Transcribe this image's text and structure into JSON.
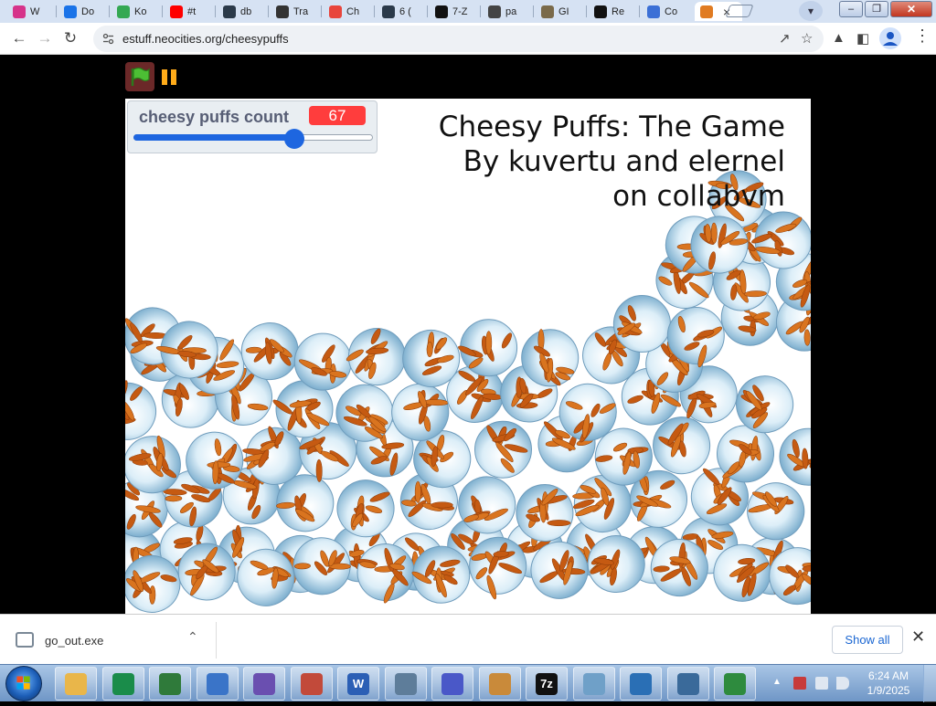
{
  "tabs": [
    {
      "label": "W",
      "icon": "webring-icon",
      "color": "#d6338a",
      "active": false
    },
    {
      "label": "Do",
      "icon": "download-icon",
      "color": "#1a73e8",
      "active": false
    },
    {
      "label": "Ko",
      "icon": "map-pin-icon",
      "color": "#34a853",
      "active": false
    },
    {
      "label": "#t",
      "icon": "youtube-icon",
      "color": "#ff0000",
      "active": false
    },
    {
      "label": "db",
      "icon": "terminal-icon",
      "color": "#2b3a4a",
      "active": false
    },
    {
      "label": "Tra",
      "icon": "lightbulb-icon",
      "color": "#333333",
      "active": false
    },
    {
      "label": "Ch",
      "icon": "chrome-icon",
      "color": "#e8453c",
      "active": false
    },
    {
      "label": "6 (",
      "icon": "terminal-icon",
      "color": "#2b3a4a",
      "active": false
    },
    {
      "label": "7-Z",
      "icon": "7zip-icon",
      "color": "#111111",
      "active": false
    },
    {
      "label": "pa",
      "icon": "archive-icon",
      "color": "#444444",
      "active": false
    },
    {
      "label": "GI",
      "icon": "gimp-icon",
      "color": "#7a6a4a",
      "active": false
    },
    {
      "label": "Re",
      "icon": "github-icon",
      "color": "#111111",
      "active": false
    },
    {
      "label": "Co",
      "icon": "search-icon",
      "color": "#3b6fd6",
      "active": false
    },
    {
      "label": "",
      "icon": "cheesy-puffs-icon",
      "color": "#e07b22",
      "active": true
    }
  ],
  "address": {
    "url": "estuff.neocities.org/cheesypuffs"
  },
  "monitor": {
    "label": "cheesy puffs count",
    "value": "67",
    "slider_fraction": 0.67,
    "accent": "#1e66e0",
    "value_color": "#ff3d3d"
  },
  "game": {
    "title_line1": "Cheesy Puffs: The Game",
    "title_line2": "By kuvertu and elernel",
    "title_line3": "on collabvm",
    "puff_count": 67
  },
  "download": {
    "filename": "go_out.exe",
    "show_all": "Show all"
  },
  "taskbar": {
    "apps": [
      {
        "icon": "explorer-folder-icon",
        "color": "#e9b64a"
      },
      {
        "icon": "green-swirl-icon",
        "color": "#1a8c4a"
      },
      {
        "icon": "globe-icon",
        "color": "#2f7a3a"
      },
      {
        "icon": "pipe-icon",
        "color": "#3a74c8"
      },
      {
        "icon": "virus-icon",
        "color": "#6a4fb0"
      },
      {
        "icon": "spider-icon",
        "color": "#c24a3a"
      },
      {
        "icon": "word-icon",
        "color": "#2b5fb5",
        "text": "W"
      },
      {
        "icon": "pc-shield-icon",
        "color": "#5e7d9a"
      },
      {
        "icon": "infinity-icon",
        "color": "#4a58c8"
      },
      {
        "icon": "paint-icon",
        "color": "#c98a3a"
      },
      {
        "icon": "7zip-icon",
        "color": "#111111",
        "text": "7z"
      },
      {
        "icon": "notepad-icon",
        "color": "#6fa0c8"
      },
      {
        "icon": "remote-desktop-icon",
        "color": "#2a6fb5"
      },
      {
        "icon": "network-icon",
        "color": "#3a6a9a"
      },
      {
        "icon": "console-icon",
        "color": "#2e8b3e"
      }
    ],
    "time": "6:24 AM",
    "date": "1/9/2025"
  }
}
